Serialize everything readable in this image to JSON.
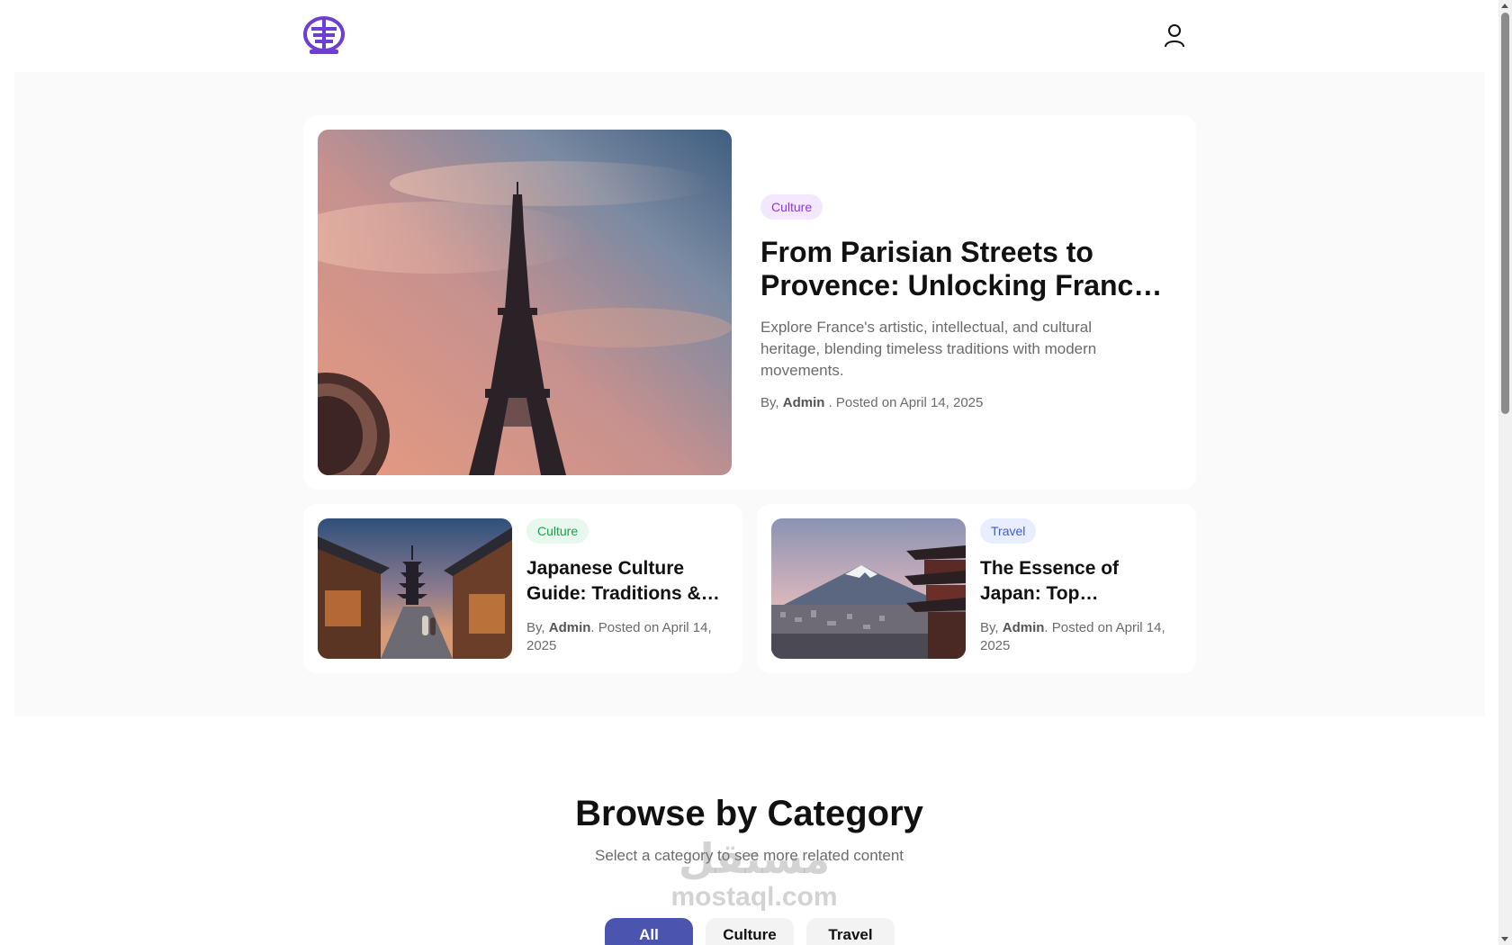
{
  "header": {
    "logo": "globe-logo-icon",
    "account_icon": "user-icon"
  },
  "featured": {
    "category": "Culture",
    "title": "From Parisian Streets to Provence: Unlocking France’s Cultural Heritage",
    "excerpt": "Explore France's artistic, intellectual, and cultural heritage, blending timeless traditions with modern movements.",
    "meta_prefix": "By,",
    "author": "Admin",
    "meta_suffix": ". Posted on April 14, 2025",
    "image": "eiffel-tower-sunset-photo"
  },
  "posts": [
    {
      "category": "Culture",
      "title": "Japanese Culture Guide: Traditions & Customs",
      "meta_prefix": "By,",
      "author": "Admin",
      "meta_suffix": ". Posted on April 14, 2025",
      "image": "kyoto-street-pagoda-photo"
    },
    {
      "category": "Travel",
      "title": "The Essence of Japan: Top Destinations",
      "meta_prefix": "By,",
      "author": "Admin",
      "meta_suffix": ". Posted on April 14, 2025",
      "image": "mount-fuji-pagoda-photo"
    }
  ],
  "browse": {
    "title": "Browse by Category",
    "subtitle": "Select a category to see more related content",
    "filters": [
      "All",
      "Culture",
      "Travel"
    ],
    "active_filter": "All"
  },
  "watermark": {
    "arabic": "مستقل",
    "latin": "mostaql.com"
  },
  "colors": {
    "accent": "#4b55b0",
    "logo": "#6d3fd1",
    "culture_badge_purple": "#9333ea",
    "culture_badge_green": "#16a34a",
    "travel_badge_blue": "#3b5bdb"
  }
}
